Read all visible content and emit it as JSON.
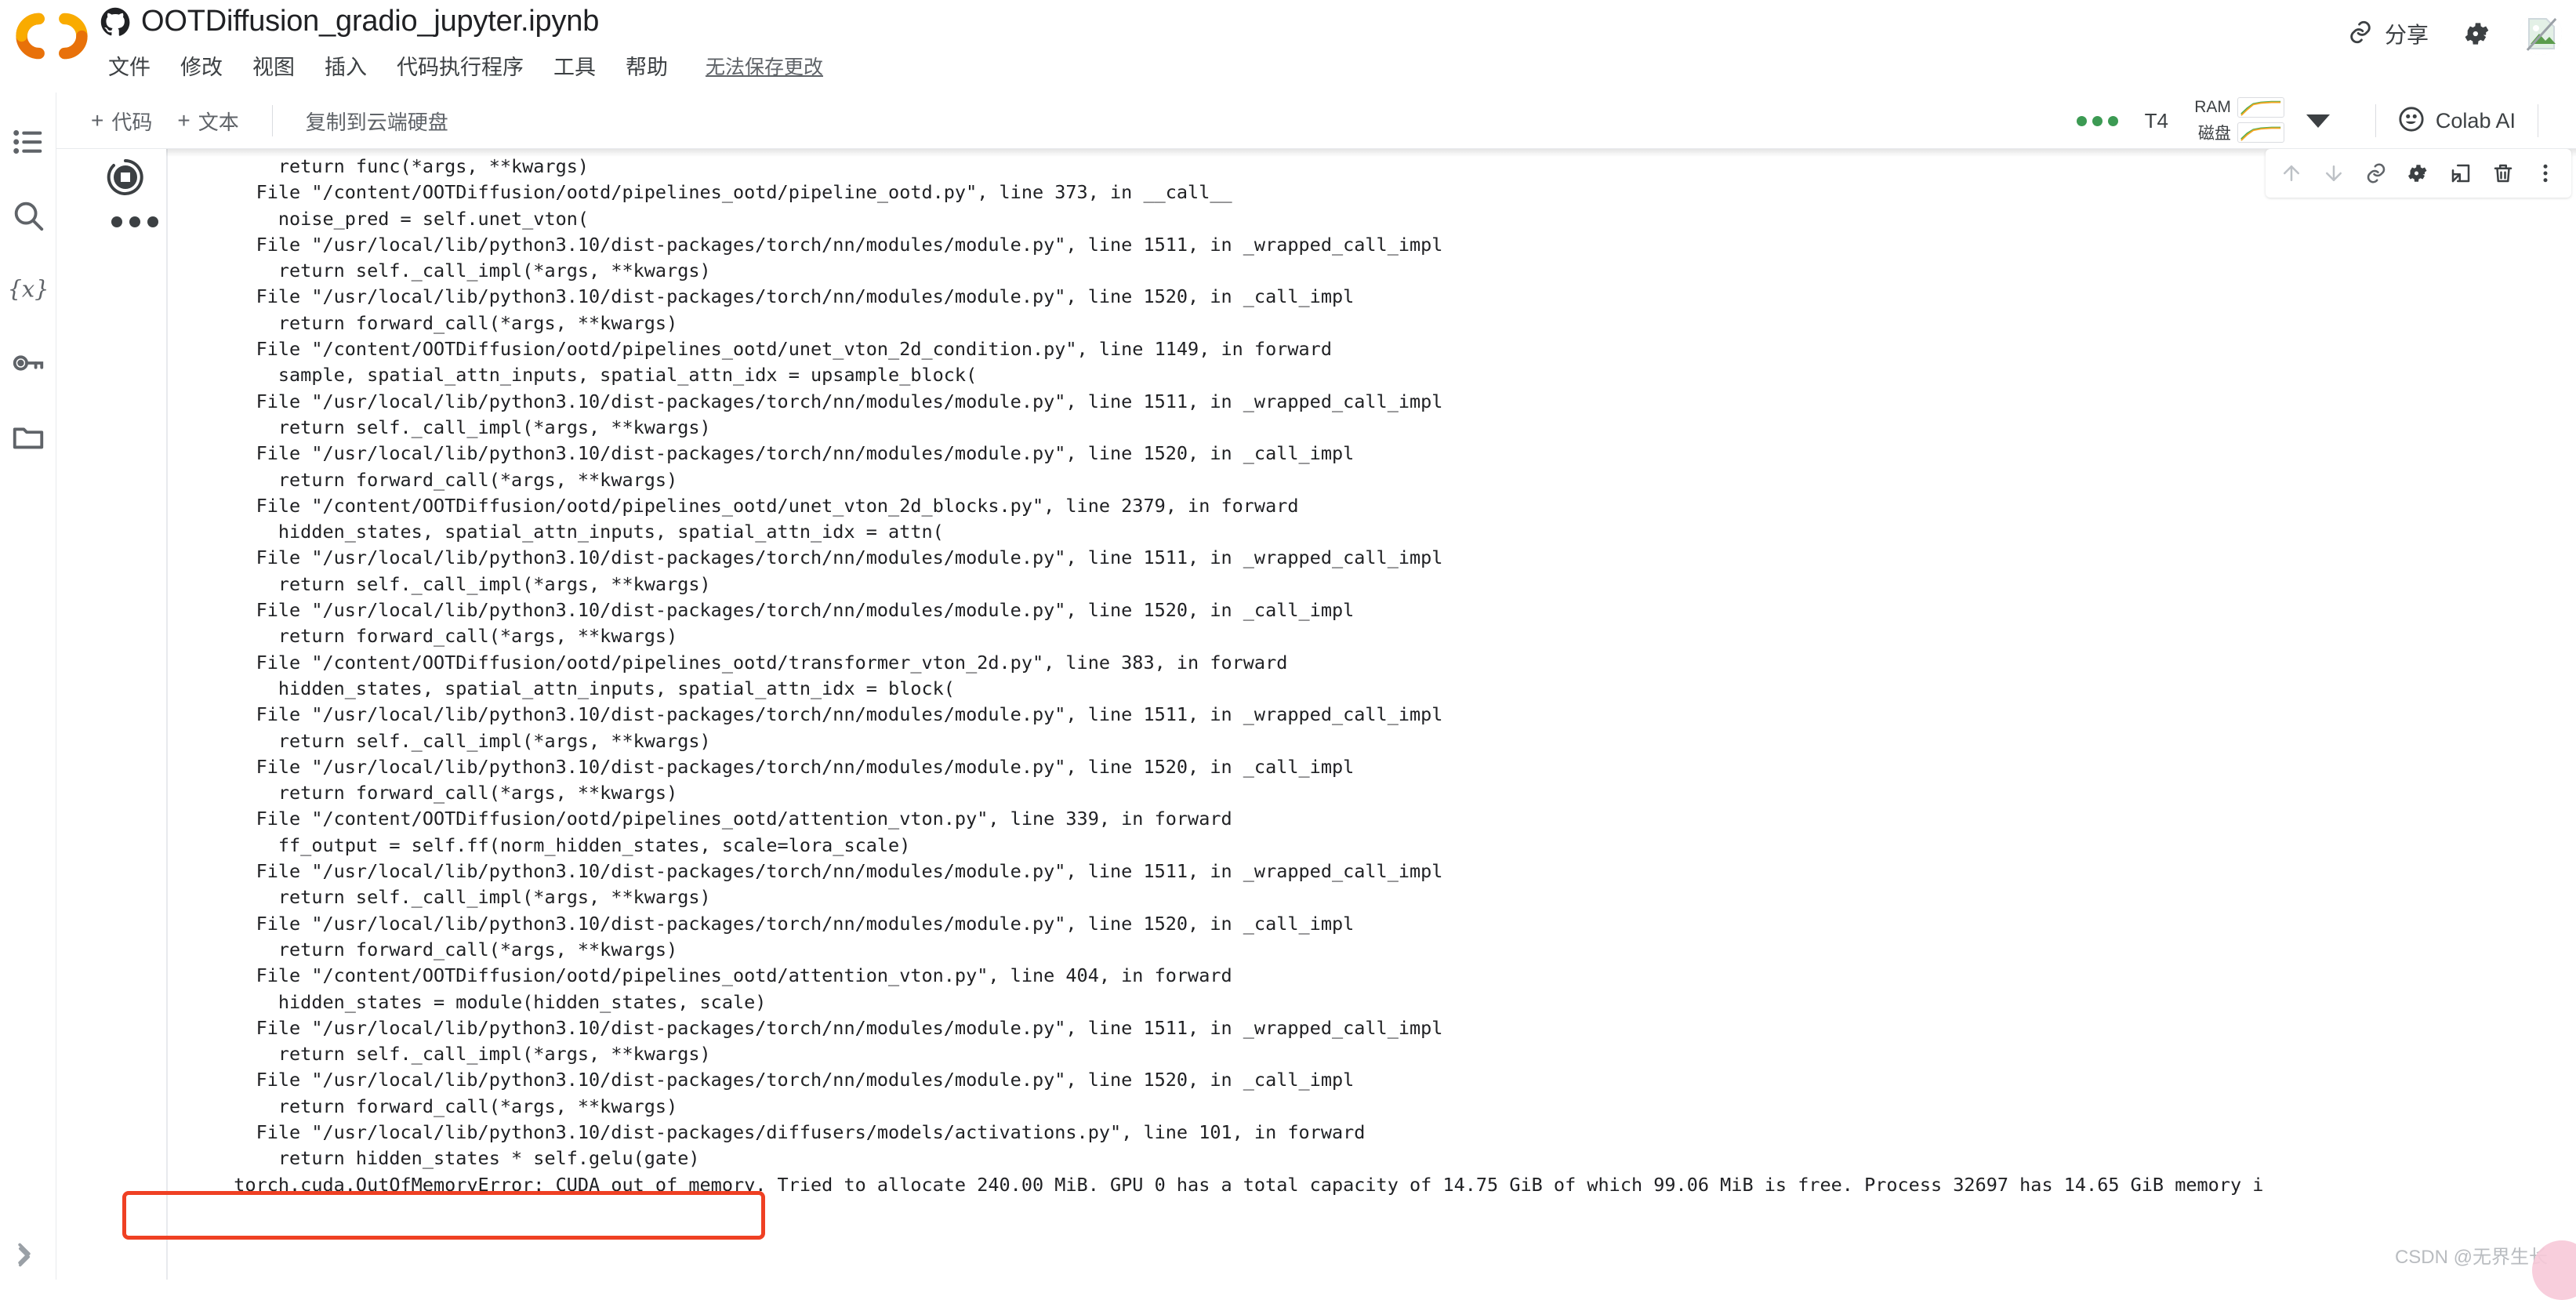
{
  "app": {
    "brand": "colab-logo",
    "notebook_title": "OOTDiffusion_gradio_jupyter.ipynb",
    "accent_orange": "#e8710a",
    "accent_red": "#ef4023",
    "text_primary": "#202124",
    "text_secondary": "#5f6368"
  },
  "menu": {
    "items": [
      "文件",
      "修改",
      "视图",
      "插入",
      "代码执行程序",
      "工具",
      "帮助"
    ],
    "save_note": "无法保存更改"
  },
  "top_right": {
    "share_label": "分享",
    "link_icon": "link-icon",
    "settings_icon": "gear-icon",
    "avatar_icon": "avatar"
  },
  "toolbar": {
    "add_code_label": "代码",
    "add_text_label": "文本",
    "plus": "+",
    "copy_to_drive_label": "复制到云端硬盘",
    "more_dots": "•••",
    "runtime_label": "T4",
    "ram_label": "RAM",
    "disk_label": "磁盘",
    "colab_ai_label": "Colab AI",
    "caret": "chevron-down-icon"
  },
  "rail": {
    "items": [
      {
        "name": "toc-icon",
        "label": "目录"
      },
      {
        "name": "search-icon",
        "label": "搜索"
      },
      {
        "name": "variables-icon",
        "label": "{x}"
      },
      {
        "name": "secrets-key-icon",
        "label": "密钥"
      },
      {
        "name": "files-folder-icon",
        "label": "文件"
      }
    ]
  },
  "cell": {
    "run_button": "stop-interrupt-button",
    "more_options": "cell-more-options",
    "toolbar_icons": [
      "move-cell-up-icon",
      "move-cell-down-icon",
      "link-to-cell-icon",
      "cell-settings-gear-icon",
      "open-in-new-tab-icon",
      "delete-cell-trash-icon",
      "more-vert-icon"
    ]
  },
  "output": {
    "highlighted_error": "torch.cuda.OutOfMemoryError: CUDA out of memory.",
    "traceback": "      return func(*args, **kwargs)\n    File \"/content/OOTDiffusion/ootd/pipelines_ootd/pipeline_ootd.py\", line 373, in __call__\n      noise_pred = self.unet_vton(\n    File \"/usr/local/lib/python3.10/dist-packages/torch/nn/modules/module.py\", line 1511, in _wrapped_call_impl\n      return self._call_impl(*args, **kwargs)\n    File \"/usr/local/lib/python3.10/dist-packages/torch/nn/modules/module.py\", line 1520, in _call_impl\n      return forward_call(*args, **kwargs)\n    File \"/content/OOTDiffusion/ootd/pipelines_ootd/unet_vton_2d_condition.py\", line 1149, in forward\n      sample, spatial_attn_inputs, spatial_attn_idx = upsample_block(\n    File \"/usr/local/lib/python3.10/dist-packages/torch/nn/modules/module.py\", line 1511, in _wrapped_call_impl\n      return self._call_impl(*args, **kwargs)\n    File \"/usr/local/lib/python3.10/dist-packages/torch/nn/modules/module.py\", line 1520, in _call_impl\n      return forward_call(*args, **kwargs)\n    File \"/content/OOTDiffusion/ootd/pipelines_ootd/unet_vton_2d_blocks.py\", line 2379, in forward\n      hidden_states, spatial_attn_inputs, spatial_attn_idx = attn(\n    File \"/usr/local/lib/python3.10/dist-packages/torch/nn/modules/module.py\", line 1511, in _wrapped_call_impl\n      return self._call_impl(*args, **kwargs)\n    File \"/usr/local/lib/python3.10/dist-packages/torch/nn/modules/module.py\", line 1520, in _call_impl\n      return forward_call(*args, **kwargs)\n    File \"/content/OOTDiffusion/ootd/pipelines_ootd/transformer_vton_2d.py\", line 383, in forward\n      hidden_states, spatial_attn_inputs, spatial_attn_idx = block(\n    File \"/usr/local/lib/python3.10/dist-packages/torch/nn/modules/module.py\", line 1511, in _wrapped_call_impl\n      return self._call_impl(*args, **kwargs)\n    File \"/usr/local/lib/python3.10/dist-packages/torch/nn/modules/module.py\", line 1520, in _call_impl\n      return forward_call(*args, **kwargs)\n    File \"/content/OOTDiffusion/ootd/pipelines_ootd/attention_vton.py\", line 339, in forward\n      ff_output = self.ff(norm_hidden_states, scale=lora_scale)\n    File \"/usr/local/lib/python3.10/dist-packages/torch/nn/modules/module.py\", line 1511, in _wrapped_call_impl\n      return self._call_impl(*args, **kwargs)\n    File \"/usr/local/lib/python3.10/dist-packages/torch/nn/modules/module.py\", line 1520, in _call_impl\n      return forward_call(*args, **kwargs)\n    File \"/content/OOTDiffusion/ootd/pipelines_ootd/attention_vton.py\", line 404, in forward\n      hidden_states = module(hidden_states, scale)\n    File \"/usr/local/lib/python3.10/dist-packages/torch/nn/modules/module.py\", line 1511, in _wrapped_call_impl\n      return self._call_impl(*args, **kwargs)\n    File \"/usr/local/lib/python3.10/dist-packages/torch/nn/modules/module.py\", line 1520, in _call_impl\n      return forward_call(*args, **kwargs)\n    File \"/usr/local/lib/python3.10/dist-packages/diffusers/models/activations.py\", line 101, in forward\n      return hidden_states * self.gelu(gate)\n  torch.cuda.OutOfMemoryError: CUDA out of memory. Tried to allocate 240.00 MiB. GPU 0 has a total capacity of 14.75 GiB of which 99.06 MiB is free. Process 32697 has 14.65 GiB memory i"
  },
  "watermark": {
    "text": "CSDN @无界生长"
  }
}
